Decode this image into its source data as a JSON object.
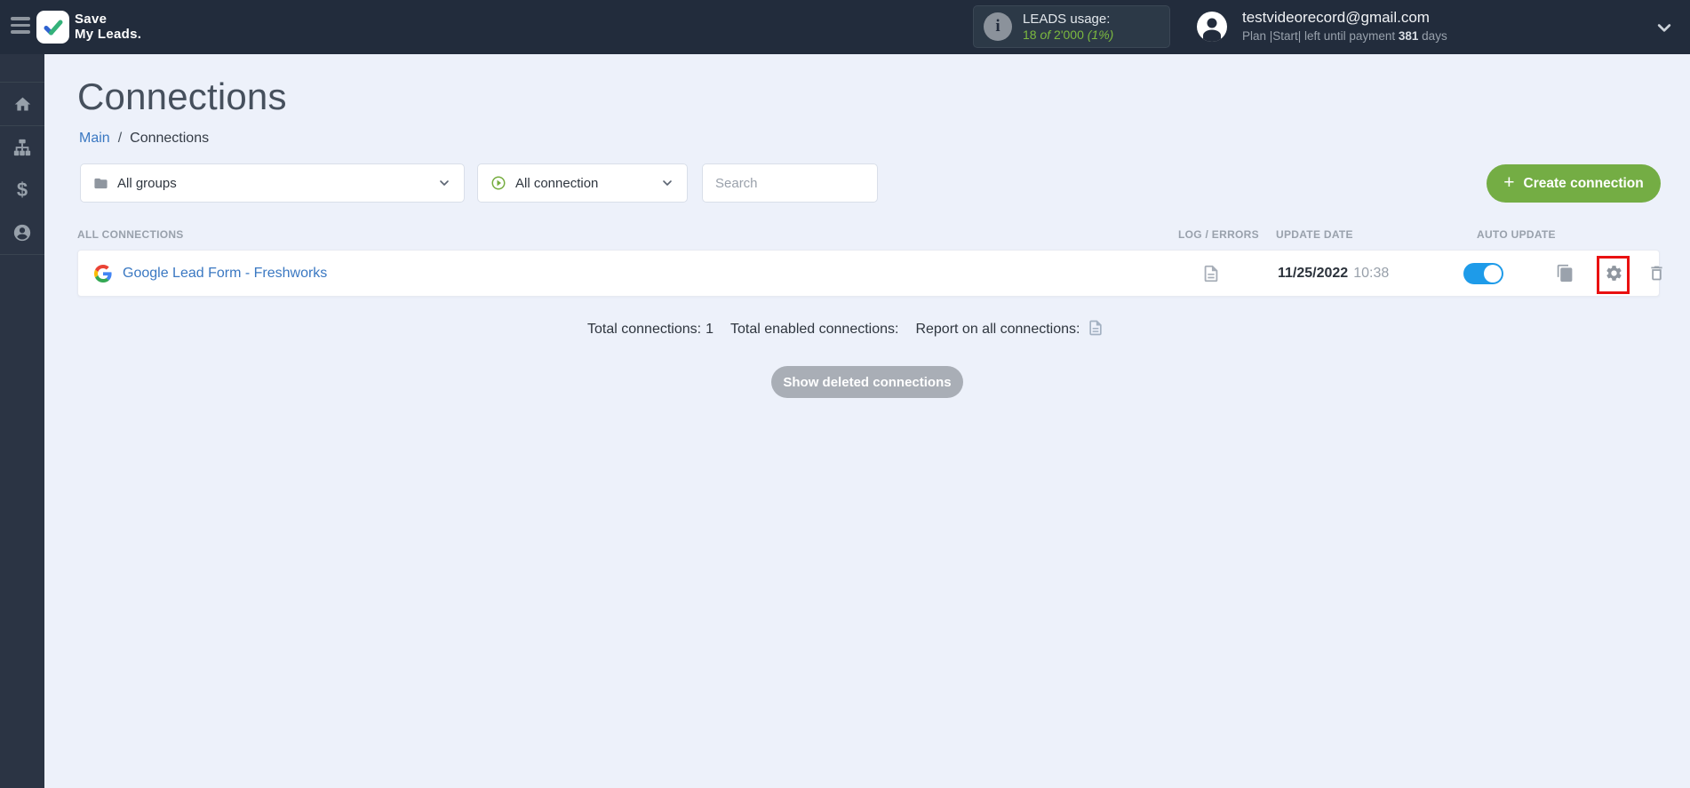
{
  "topbar": {
    "brand": {
      "line1": "Save",
      "line2": "My Leads."
    },
    "leads_usage": {
      "label": "LEADS usage:",
      "used": "18",
      "of_word": "of",
      "total": "2'000",
      "percent": "(1%)"
    },
    "account": {
      "email": "testvideorecord@gmail.com",
      "plan_prefix": "Plan |Start| left until payment",
      "days": "381",
      "days_word": "days"
    }
  },
  "sidebar": {
    "items": [
      {
        "icon": "home-icon"
      },
      {
        "icon": "connections-tree-icon"
      },
      {
        "icon": "billing-dollar-icon"
      },
      {
        "icon": "account-user-icon"
      }
    ]
  },
  "page": {
    "title": "Connections",
    "breadcrumb": {
      "root": "Main",
      "separator": "/",
      "current": "Connections"
    }
  },
  "filters": {
    "groups_selected": "All groups",
    "connection_selected": "All connection",
    "search_placeholder": "Search",
    "create_button": "Create connection"
  },
  "table": {
    "headers": {
      "connections": "ALL CONNECTIONS",
      "log_errors": "LOG / ERRORS",
      "update_date": "UPDATE DATE",
      "auto_update": "AUTO UPDATE"
    },
    "rows": [
      {
        "name": "Google Lead Form - Freshworks",
        "source_icon": "google-icon",
        "update_date": "11/25/2022",
        "update_time": "10:38",
        "auto_update_enabled": true
      }
    ]
  },
  "summary": {
    "total_connections_label": "Total connections:",
    "total_connections_value": "1",
    "total_enabled_label": "Total enabled connections:",
    "report_label": "Report on all connections:"
  },
  "footer_actions": {
    "show_deleted": "Show deleted connections"
  },
  "icons": {
    "dollar_glyph": "$",
    "info_glyph": "i",
    "plus_glyph": "+"
  },
  "colors": {
    "topbar_bg": "#222c3c",
    "sidebar_bg": "#2b3444",
    "page_bg": "#edf1fa",
    "accent_green": "#74ad44",
    "usage_green": "#7cb93f",
    "link_blue": "#3a78c2",
    "toggle_blue": "#1e9be9",
    "muted_gray": "#99a1ac",
    "highlight_red": "#e91111"
  }
}
